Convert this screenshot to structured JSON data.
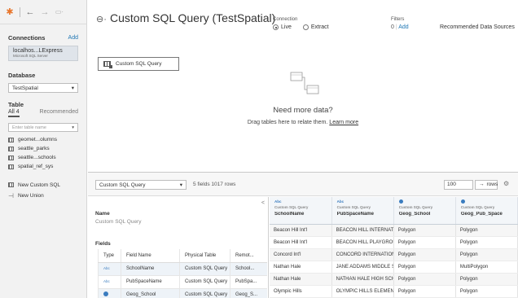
{
  "nav": {
    "logo_icon": "tableau-logo-icon",
    "back_icon": "back-arrow-icon",
    "forward_icon": "forward-arrow-icon",
    "save_icon": "save-icon"
  },
  "sidebar": {
    "connections_label": "Connections",
    "connections_add": "Add",
    "connection": {
      "name": "localhos...LExpress",
      "type": "Microsoft SQL Server"
    },
    "database_label": "Database",
    "database_value": "TestSpatial",
    "table_label": "Table",
    "tab_all": "All 4",
    "tab_recommended": "Recommended",
    "filter_placeholder": "Enter table name",
    "tables": [
      "geomet...olumns",
      "seattle_parks",
      "seattle...schools",
      "spatial_ref_sys"
    ],
    "new_custom_sql": "New Custom SQL",
    "new_union": "New Union"
  },
  "header": {
    "title": "Custom SQL Query (TestSpatial)",
    "connection_label": "Connection",
    "live": "Live",
    "extract": "Extract",
    "filters_label": "Filters",
    "filters_count": "0",
    "filters_sep": "|",
    "filters_add": "Add",
    "recommended_sources": "Recommended Data Sources"
  },
  "canvas": {
    "query_card": "Custom SQL Query",
    "need_more": "Need more data?",
    "drag_text": "Drag tables here to relate them.",
    "learn_more": "Learn more"
  },
  "toolbar": {
    "table_select": "Custom SQL Query",
    "info": "5 fields 1017 rows",
    "rows_value": "100",
    "rows_label": "rows",
    "arrow": "→"
  },
  "metadata": {
    "collapse_glyph": "<",
    "name_label": "Name",
    "name_value": "Custom SQL Query",
    "fields_label": "Fields",
    "columns": [
      "Type",
      "Field Name",
      "Physical Table",
      "Remot..."
    ],
    "rows": [
      {
        "type": "Abc",
        "field": "SchoolName",
        "table": "Custom SQL Query",
        "remote": "School..."
      },
      {
        "type": "Abc",
        "field": "PubSpaceName",
        "table": "Custom SQL Query",
        "remote": "PubSpa..."
      },
      {
        "type": "geo",
        "field": "Geog_School",
        "table": "Custom SQL Query",
        "remote": "Geog_S..."
      }
    ]
  },
  "grid": {
    "headers": [
      {
        "type": "Abc",
        "source": "Custom SQL Query",
        "name": "SchoolName"
      },
      {
        "type": "Abc",
        "source": "Custom SQL Query",
        "name": "PubSpaceName"
      },
      {
        "type": "geo",
        "source": "Custom SQL Query",
        "name": "Geog_School"
      },
      {
        "type": "geo",
        "source": "Custom SQL Query",
        "name": "Geog_Pub_Space"
      }
    ],
    "rows": [
      [
        "Beacon Hill Int'l",
        "BEACON HILL INTERNATION...",
        "Polygon",
        "Polygon"
      ],
      [
        "Beacon Hill Int'l",
        "BEACON HILL PLAYGROUND",
        "Polygon",
        "Polygon"
      ],
      [
        "Concord Int'l",
        "CONCORD INTERNATIONAL ...",
        "Polygon",
        "Polygon"
      ],
      [
        "Nathan Hale",
        "JANE ADDAMS MIDDLE SCH...",
        "Polygon",
        "MultiPolygon"
      ],
      [
        "Nathan Hale",
        "NATHAN HALE HIGH SCHOOL",
        "Polygon",
        "Polygon"
      ],
      [
        "Olympic Hills",
        "OLYMPIC HILLS ELEMENTARY",
        "Polygon",
        "Polygon"
      ]
    ]
  },
  "colors": {
    "accent": "#1f77b4",
    "geo": "#3a7cbf",
    "sidebar_bg": "#f2f2f2"
  }
}
